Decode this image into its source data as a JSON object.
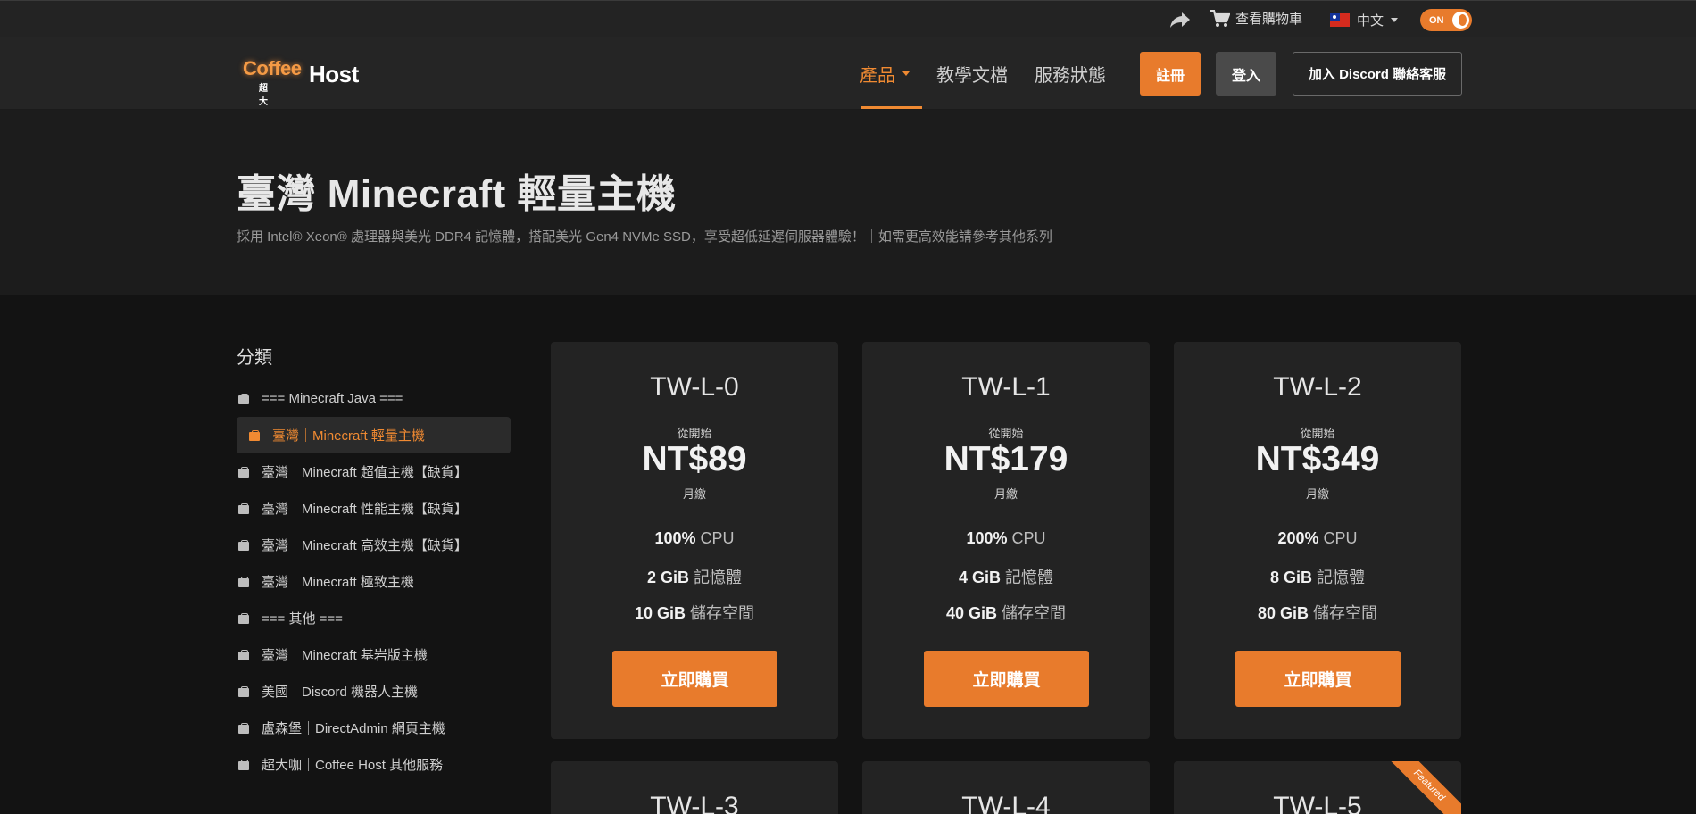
{
  "topbar": {
    "cart_label": "查看購物車",
    "language": "中文",
    "theme_toggle": "ON"
  },
  "logo": {
    "part1": "Coffee",
    "part2": "Host",
    "sub": "超大咖託管"
  },
  "nav": {
    "items": [
      {
        "label": "產品",
        "active": true
      },
      {
        "label": "教學文檔"
      },
      {
        "label": "服務狀態"
      }
    ],
    "register": "註冊",
    "login": "登入",
    "discord": "加入 Discord 聯絡客服"
  },
  "hero": {
    "title": "臺灣 Minecraft 輕量主機",
    "subtitle": "採用 Intel® Xeon® 處理器與美光 DDR4 記憶體，搭配美光 Gen4 NVMe SSD，享受超低延遲伺服器體驗！｜如需更高效能請參考其他系列"
  },
  "sidebar": {
    "title": "分類",
    "items": [
      "=== Minecraft Java ===",
      "臺灣｜Minecraft 輕量主機",
      "臺灣｜Minecraft 超值主機【缺貨】",
      "臺灣｜Minecraft 性能主機【缺貨】",
      "臺灣｜Minecraft 高效主機【缺貨】",
      "臺灣｜Minecraft 極致主機",
      "=== 其他 ===",
      "臺灣｜Minecraft 基岩版主機",
      "美國｜Discord 機器人主機",
      "盧森堡｜DirectAdmin 網頁主機",
      "超大咖｜Coffee Host 其他服務"
    ]
  },
  "products": [
    {
      "name": "TW-L-0",
      "from": "從開始",
      "price": "NT$89",
      "cycle": "月繳",
      "cpu_val": "100%",
      "cpu_unit": "CPU",
      "ram_val": "2 GiB",
      "ram_unit": "記憶體",
      "disk_val": "10 GiB",
      "disk_unit": "儲存空間",
      "buy": "立即購買"
    },
    {
      "name": "TW-L-1",
      "from": "從開始",
      "price": "NT$179",
      "cycle": "月繳",
      "cpu_val": "100%",
      "cpu_unit": "CPU",
      "ram_val": "4 GiB",
      "ram_unit": "記憶體",
      "disk_val": "40 GiB",
      "disk_unit": "儲存空間",
      "buy": "立即購買"
    },
    {
      "name": "TW-L-2",
      "from": "從開始",
      "price": "NT$349",
      "cycle": "月繳",
      "cpu_val": "200%",
      "cpu_unit": "CPU",
      "ram_val": "8 GiB",
      "ram_unit": "記憶體",
      "disk_val": "80 GiB",
      "disk_unit": "儲存空間",
      "buy": "立即購買"
    },
    {
      "name": "TW-L-3"
    },
    {
      "name": "TW-L-4"
    },
    {
      "name": "TW-L-5",
      "ribbon": "Featured"
    }
  ],
  "colors": {
    "accent": "#e87b2c",
    "background": "#131313",
    "card": "#232323"
  }
}
